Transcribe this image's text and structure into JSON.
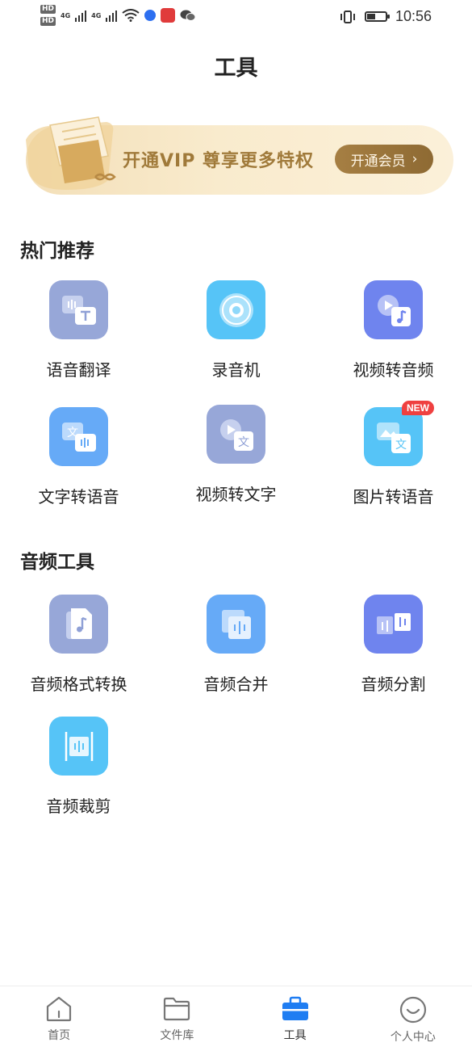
{
  "status_bar": {
    "sim1": "HD",
    "sim2": "HD",
    "net1": "4G",
    "net2": "4G",
    "time": "10:56"
  },
  "header": {
    "title": "工具"
  },
  "vip_banner": {
    "text": "开通VIP 尊享更多特权",
    "button_label": "开通会员",
    "button_arrow": "›"
  },
  "sections": {
    "hot": {
      "title": "热门推荐",
      "items": [
        {
          "label": "语音翻译",
          "icon": "voice-translate-icon",
          "color": "#97a7d8"
        },
        {
          "label": "录音机",
          "icon": "recorder-icon",
          "color": "#56c4f7"
        },
        {
          "label": "视频转音频",
          "icon": "video-to-audio-icon",
          "color": "#6f84ee"
        },
        {
          "label": "文字转语音",
          "icon": "text-to-speech-icon",
          "color": "#66aaf7"
        },
        {
          "label": "视频转文字",
          "icon": "video-to-text-icon",
          "color": "#97a7d8"
        },
        {
          "label": "图片转语音",
          "icon": "image-to-speech-icon",
          "color": "#56c4f7",
          "badge": "NEW"
        }
      ]
    },
    "audio": {
      "title": "音频工具",
      "items": [
        {
          "label": "音频格式转换",
          "icon": "audio-format-convert-icon",
          "color": "#97a7d8"
        },
        {
          "label": "音频合并",
          "icon": "audio-merge-icon",
          "color": "#66aaf7"
        },
        {
          "label": "音频分割",
          "icon": "audio-split-icon",
          "color": "#6f84ee"
        },
        {
          "label": "音频裁剪",
          "icon": "audio-trim-icon",
          "color": "#56c4f7"
        }
      ]
    }
  },
  "bottom_nav": {
    "items": [
      {
        "label": "首页",
        "icon": "home-icon"
      },
      {
        "label": "文件库",
        "icon": "folder-icon"
      },
      {
        "label": "工具",
        "icon": "toolbox-icon",
        "active": true
      },
      {
        "label": "个人中心",
        "icon": "profile-icon"
      }
    ],
    "accent": "#1f7df2"
  }
}
